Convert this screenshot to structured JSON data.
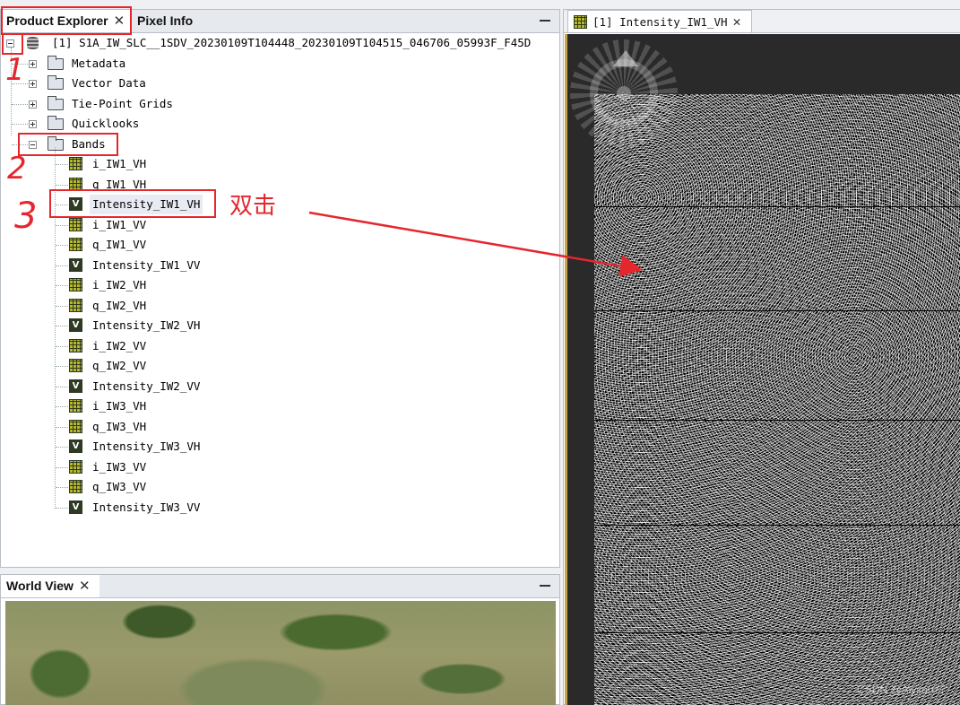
{
  "left_panel": {
    "tabs": [
      {
        "label": "Product Explorer",
        "close": "✕"
      },
      {
        "label": "Pixel Info"
      }
    ]
  },
  "tree": {
    "root": "[1] S1A_IW_SLC__1SDV_20230109T104448_20230109T104515_046706_05993F_F45D",
    "folders": [
      "Metadata",
      "Vector Data",
      "Tie-Point Grids",
      "Quicklooks",
      "Bands"
    ],
    "bands": [
      {
        "label": "i_IW1_VH",
        "type": "grid"
      },
      {
        "label": "q_IW1_VH",
        "type": "grid"
      },
      {
        "label": "Intensity_IW1_VH",
        "type": "virtual"
      },
      {
        "label": "i_IW1_VV",
        "type": "grid"
      },
      {
        "label": "q_IW1_VV",
        "type": "grid"
      },
      {
        "label": "Intensity_IW1_VV",
        "type": "virtual"
      },
      {
        "label": "i_IW2_VH",
        "type": "grid"
      },
      {
        "label": "q_IW2_VH",
        "type": "grid"
      },
      {
        "label": "Intensity_IW2_VH",
        "type": "virtual"
      },
      {
        "label": "i_IW2_VV",
        "type": "grid"
      },
      {
        "label": "q_IW2_VV",
        "type": "grid"
      },
      {
        "label": "Intensity_IW2_VV",
        "type": "virtual"
      },
      {
        "label": "i_IW3_VH",
        "type": "grid"
      },
      {
        "label": "q_IW3_VH",
        "type": "grid"
      },
      {
        "label": "Intensity_IW3_VH",
        "type": "virtual"
      },
      {
        "label": "i_IW3_VV",
        "type": "grid"
      },
      {
        "label": "q_IW3_VV",
        "type": "grid"
      },
      {
        "label": "Intensity_IW3_VV",
        "type": "virtual"
      }
    ],
    "virtual_icon_letter": "V"
  },
  "world_view": {
    "tab_label": "World View",
    "close": "✕"
  },
  "image_view": {
    "tab_label": "[1] Intensity_IW1_VH",
    "close": "✕"
  },
  "annotations": {
    "step1": "1",
    "step2": "2",
    "step3": "3",
    "double_click": "双击",
    "accent_color": "#e5262d"
  },
  "watermark": "CSDN @Alyson77"
}
